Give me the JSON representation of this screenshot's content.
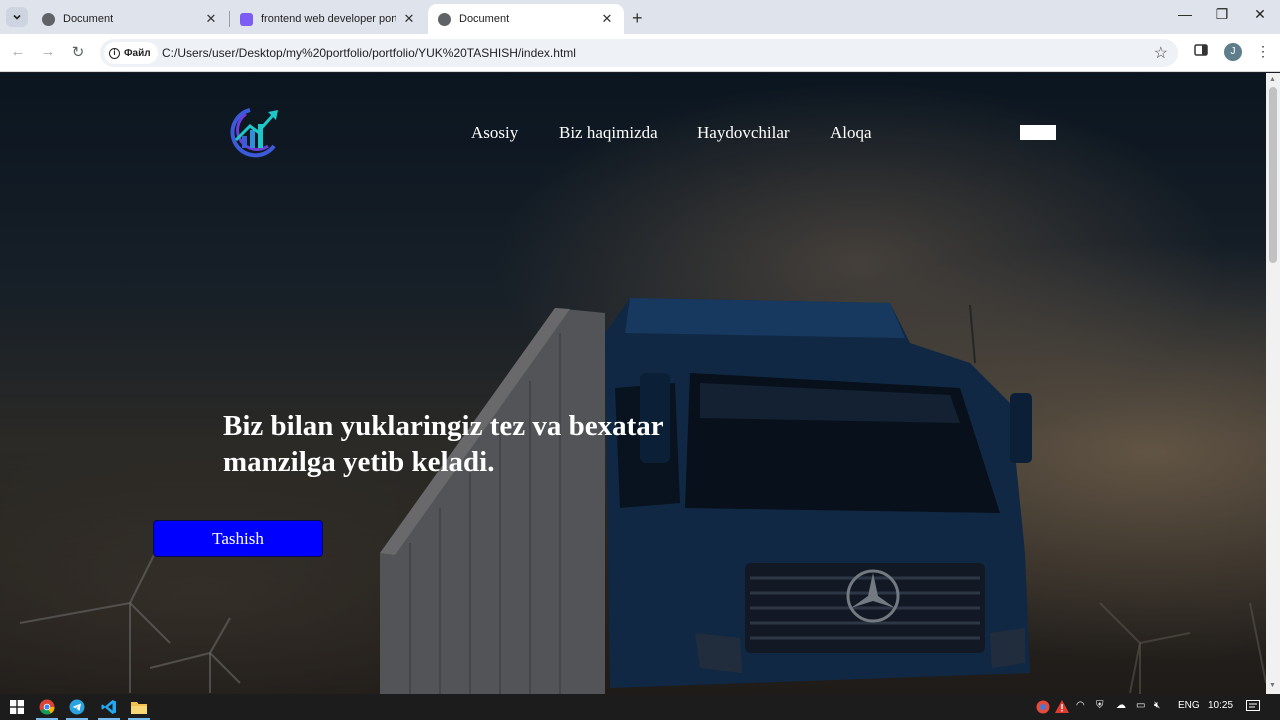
{
  "browser": {
    "tabs": [
      {
        "title": "Document",
        "active": false,
        "favicon": "globe-icon"
      },
      {
        "title": "frontend web developer portfolio",
        "active": false,
        "favicon": "pen-icon"
      },
      {
        "title": "Document",
        "active": true,
        "favicon": "globe-icon"
      }
    ],
    "site_info_label": "Файл",
    "url": "C:/Users/user/Desktop/my%20portfolio/portfolio/YUK%20TASHISH/index.html",
    "profile_initial": "J"
  },
  "site": {
    "nav": [
      "Asosiy",
      "Biz haqimizda",
      "Haydovchilar",
      "Aloqa"
    ],
    "hero_title": "Biz bilan yuklaringiz tez va bexatar manzilga yetib keladi.",
    "cta_label": "Tashish",
    "colors": {
      "cta": "#0000ff",
      "logo_blue": "#3b5bdb",
      "logo_teal": "#1fc8c8"
    }
  },
  "taskbar": {
    "apps": [
      "windows-start-icon",
      "chrome-icon",
      "telegram-icon",
      "vscode-icon",
      "file-explorer-icon"
    ],
    "language": "ENG",
    "time": "10:25"
  }
}
